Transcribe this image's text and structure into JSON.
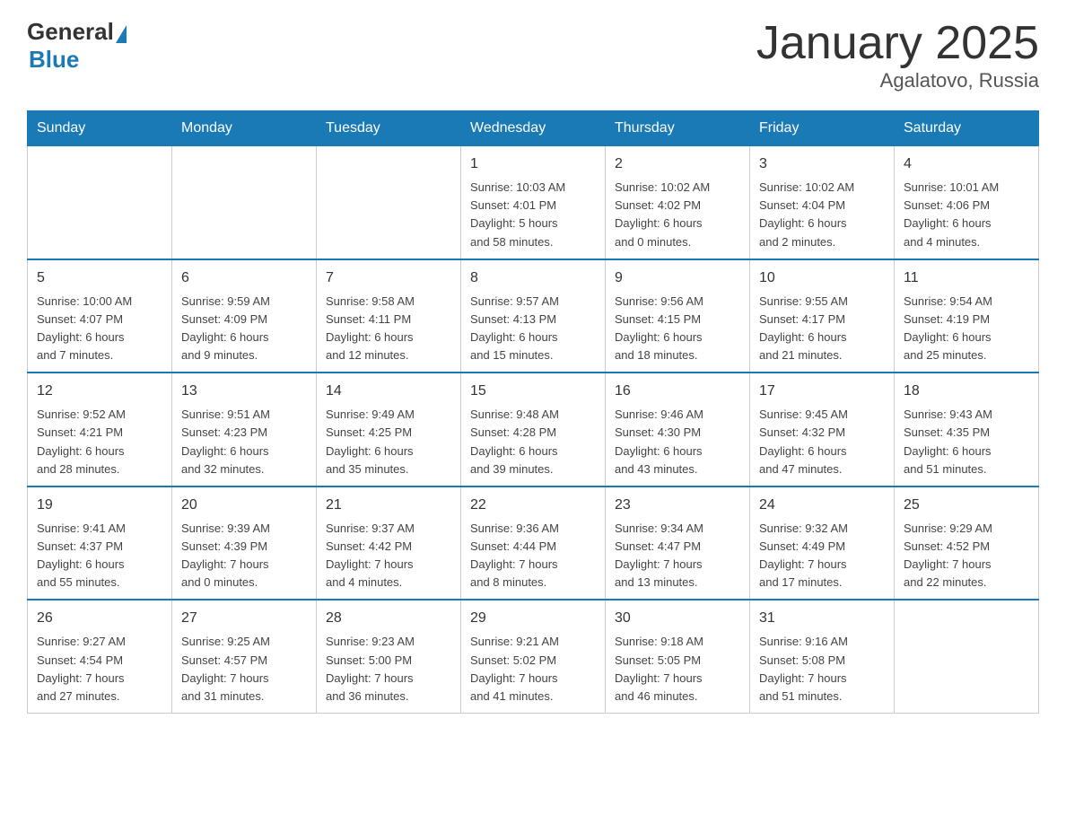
{
  "header": {
    "logo_general": "General",
    "logo_blue": "Blue",
    "title": "January 2025",
    "subtitle": "Agalatovo, Russia"
  },
  "days_of_week": [
    "Sunday",
    "Monday",
    "Tuesday",
    "Wednesday",
    "Thursday",
    "Friday",
    "Saturday"
  ],
  "weeks": [
    [
      {
        "day": "",
        "info": ""
      },
      {
        "day": "",
        "info": ""
      },
      {
        "day": "",
        "info": ""
      },
      {
        "day": "1",
        "info": "Sunrise: 10:03 AM\nSunset: 4:01 PM\nDaylight: 5 hours\nand 58 minutes."
      },
      {
        "day": "2",
        "info": "Sunrise: 10:02 AM\nSunset: 4:02 PM\nDaylight: 6 hours\nand 0 minutes."
      },
      {
        "day": "3",
        "info": "Sunrise: 10:02 AM\nSunset: 4:04 PM\nDaylight: 6 hours\nand 2 minutes."
      },
      {
        "day": "4",
        "info": "Sunrise: 10:01 AM\nSunset: 4:06 PM\nDaylight: 6 hours\nand 4 minutes."
      }
    ],
    [
      {
        "day": "5",
        "info": "Sunrise: 10:00 AM\nSunset: 4:07 PM\nDaylight: 6 hours\nand 7 minutes."
      },
      {
        "day": "6",
        "info": "Sunrise: 9:59 AM\nSunset: 4:09 PM\nDaylight: 6 hours\nand 9 minutes."
      },
      {
        "day": "7",
        "info": "Sunrise: 9:58 AM\nSunset: 4:11 PM\nDaylight: 6 hours\nand 12 minutes."
      },
      {
        "day": "8",
        "info": "Sunrise: 9:57 AM\nSunset: 4:13 PM\nDaylight: 6 hours\nand 15 minutes."
      },
      {
        "day": "9",
        "info": "Sunrise: 9:56 AM\nSunset: 4:15 PM\nDaylight: 6 hours\nand 18 minutes."
      },
      {
        "day": "10",
        "info": "Sunrise: 9:55 AM\nSunset: 4:17 PM\nDaylight: 6 hours\nand 21 minutes."
      },
      {
        "day": "11",
        "info": "Sunrise: 9:54 AM\nSunset: 4:19 PM\nDaylight: 6 hours\nand 25 minutes."
      }
    ],
    [
      {
        "day": "12",
        "info": "Sunrise: 9:52 AM\nSunset: 4:21 PM\nDaylight: 6 hours\nand 28 minutes."
      },
      {
        "day": "13",
        "info": "Sunrise: 9:51 AM\nSunset: 4:23 PM\nDaylight: 6 hours\nand 32 minutes."
      },
      {
        "day": "14",
        "info": "Sunrise: 9:49 AM\nSunset: 4:25 PM\nDaylight: 6 hours\nand 35 minutes."
      },
      {
        "day": "15",
        "info": "Sunrise: 9:48 AM\nSunset: 4:28 PM\nDaylight: 6 hours\nand 39 minutes."
      },
      {
        "day": "16",
        "info": "Sunrise: 9:46 AM\nSunset: 4:30 PM\nDaylight: 6 hours\nand 43 minutes."
      },
      {
        "day": "17",
        "info": "Sunrise: 9:45 AM\nSunset: 4:32 PM\nDaylight: 6 hours\nand 47 minutes."
      },
      {
        "day": "18",
        "info": "Sunrise: 9:43 AM\nSunset: 4:35 PM\nDaylight: 6 hours\nand 51 minutes."
      }
    ],
    [
      {
        "day": "19",
        "info": "Sunrise: 9:41 AM\nSunset: 4:37 PM\nDaylight: 6 hours\nand 55 minutes."
      },
      {
        "day": "20",
        "info": "Sunrise: 9:39 AM\nSunset: 4:39 PM\nDaylight: 7 hours\nand 0 minutes."
      },
      {
        "day": "21",
        "info": "Sunrise: 9:37 AM\nSunset: 4:42 PM\nDaylight: 7 hours\nand 4 minutes."
      },
      {
        "day": "22",
        "info": "Sunrise: 9:36 AM\nSunset: 4:44 PM\nDaylight: 7 hours\nand 8 minutes."
      },
      {
        "day": "23",
        "info": "Sunrise: 9:34 AM\nSunset: 4:47 PM\nDaylight: 7 hours\nand 13 minutes."
      },
      {
        "day": "24",
        "info": "Sunrise: 9:32 AM\nSunset: 4:49 PM\nDaylight: 7 hours\nand 17 minutes."
      },
      {
        "day": "25",
        "info": "Sunrise: 9:29 AM\nSunset: 4:52 PM\nDaylight: 7 hours\nand 22 minutes."
      }
    ],
    [
      {
        "day": "26",
        "info": "Sunrise: 9:27 AM\nSunset: 4:54 PM\nDaylight: 7 hours\nand 27 minutes."
      },
      {
        "day": "27",
        "info": "Sunrise: 9:25 AM\nSunset: 4:57 PM\nDaylight: 7 hours\nand 31 minutes."
      },
      {
        "day": "28",
        "info": "Sunrise: 9:23 AM\nSunset: 5:00 PM\nDaylight: 7 hours\nand 36 minutes."
      },
      {
        "day": "29",
        "info": "Sunrise: 9:21 AM\nSunset: 5:02 PM\nDaylight: 7 hours\nand 41 minutes."
      },
      {
        "day": "30",
        "info": "Sunrise: 9:18 AM\nSunset: 5:05 PM\nDaylight: 7 hours\nand 46 minutes."
      },
      {
        "day": "31",
        "info": "Sunrise: 9:16 AM\nSunset: 5:08 PM\nDaylight: 7 hours\nand 51 minutes."
      },
      {
        "day": "",
        "info": ""
      }
    ]
  ]
}
